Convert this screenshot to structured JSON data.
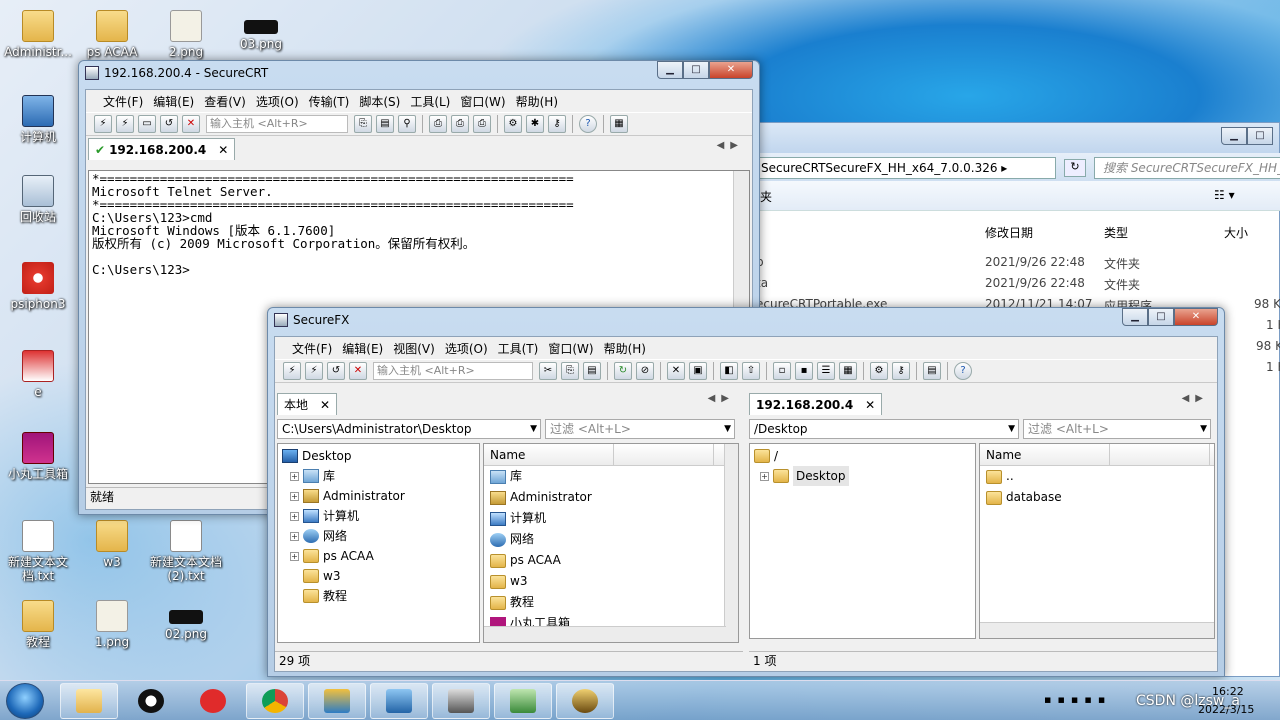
{
  "desktop_icons": [
    {
      "label": "Administr...",
      "kind": "folder"
    },
    {
      "label": "ps ACAA",
      "kind": "folder"
    },
    {
      "label": "2.png",
      "kind": "png"
    },
    {
      "label": "03.png",
      "kind": "black"
    },
    {
      "label": "计算机",
      "kind": "pc"
    },
    {
      "label": "回收站",
      "kind": "bin"
    },
    {
      "label": "psiphon3",
      "kind": "red"
    },
    {
      "label": "e",
      "kind": "e"
    },
    {
      "label": "小丸工具箱",
      "kind": "tool"
    },
    {
      "label": "新建文本文档.txt",
      "kind": "txt"
    },
    {
      "label": "w3",
      "kind": "folder"
    },
    {
      "label": "新建文本文档 (2).txt",
      "kind": "txt"
    },
    {
      "label": "教程",
      "kind": "folder"
    },
    {
      "label": "1.png",
      "kind": "png"
    },
    {
      "label": "02.png",
      "kind": "black"
    }
  ],
  "explorer": {
    "path": "SecureCRTSecureFX_HH_x64_7.0.0.326",
    "search_placeholder": "搜索 SecureCRTSecureFX_HH_x...",
    "crumb": "夹",
    "cols": {
      "date": "修改日期",
      "type": "类型",
      "size": "大小"
    },
    "rows": [
      {
        "name": "p",
        "date": "2021/9/26 22:48",
        "type": "文件夹",
        "size": ""
      },
      {
        "name": "ta",
        "date": "2021/9/26 22:48",
        "type": "文件夹",
        "size": ""
      },
      {
        "name": "ecureCRTPortable.exe",
        "date": "2012/11/21 14:07",
        "type": "应用程序",
        "size": "98 K"
      }
    ],
    "extra_sizes": [
      "1 K",
      "98 K",
      "1 K"
    ]
  },
  "securecrt": {
    "title": "192.168.200.4 - SecureCRT",
    "menu": [
      "文件(F)",
      "编辑(E)",
      "查看(V)",
      "选项(O)",
      "传输(T)",
      "脚本(S)",
      "工具(L)",
      "窗口(W)",
      "帮助(H)"
    ],
    "host_placeholder": "输入主机 <Alt+R>",
    "tab": "192.168.200.4",
    "terminal": "*===============================================================\nMicrosoft Telnet Server.\n*===============================================================\nC:\\Users\\123>cmd\nMicrosoft Windows [版本 6.1.7600]\n版权所有 (c) 2009 Microsoft Corporation。保留所有权利。\n\nC:\\Users\\123>",
    "status": "就绪"
  },
  "securefx": {
    "title": "SecureFX",
    "menu": [
      "文件(F)",
      "编辑(E)",
      "视图(V)",
      "选项(O)",
      "工具(T)",
      "窗口(W)",
      "帮助(H)"
    ],
    "host_placeholder": "输入主机 <Alt+R>",
    "left_tab": "本地",
    "right_tab": "192.168.200.4",
    "left_path": "C:\\Users\\Administrator\\Desktop",
    "right_path": "/Desktop",
    "filter_placeholder": "过滤 <Alt+L>",
    "left_tree": [
      {
        "label": "Desktop",
        "icon": "desk",
        "exp": ""
      },
      {
        "label": "库",
        "icon": "lib",
        "exp": "+"
      },
      {
        "label": "Administrator",
        "icon": "user",
        "exp": "+"
      },
      {
        "label": "计算机",
        "icon": "pc",
        "exp": "+"
      },
      {
        "label": "网络",
        "icon": "net",
        "exp": "+"
      },
      {
        "label": "ps ACAA",
        "icon": "folder",
        "exp": "+"
      },
      {
        "label": "w3",
        "icon": "folder",
        "exp": ""
      },
      {
        "label": "教程",
        "icon": "folder",
        "exp": ""
      }
    ],
    "name_col": "Name",
    "left_list": [
      {
        "label": "库",
        "icon": "lib"
      },
      {
        "label": "Administrator",
        "icon": "user"
      },
      {
        "label": "计算机",
        "icon": "pc"
      },
      {
        "label": "网络",
        "icon": "net"
      },
      {
        "label": "ps ACAA",
        "icon": "folder"
      },
      {
        "label": "w3",
        "icon": "folder"
      },
      {
        "label": "教程",
        "icon": "folder"
      },
      {
        "label": "小丸工具箱",
        "icon": "tool"
      }
    ],
    "right_tree": [
      {
        "label": "/",
        "exp": ""
      },
      {
        "label": "Desktop",
        "exp": "+"
      }
    ],
    "right_list": [
      "..",
      "database"
    ],
    "left_status": "29 项",
    "right_status": "1 项"
  },
  "tray": {
    "time": "16:22",
    "date": "2022/3/15",
    "watermark": "CSDN @lzsw_a"
  }
}
